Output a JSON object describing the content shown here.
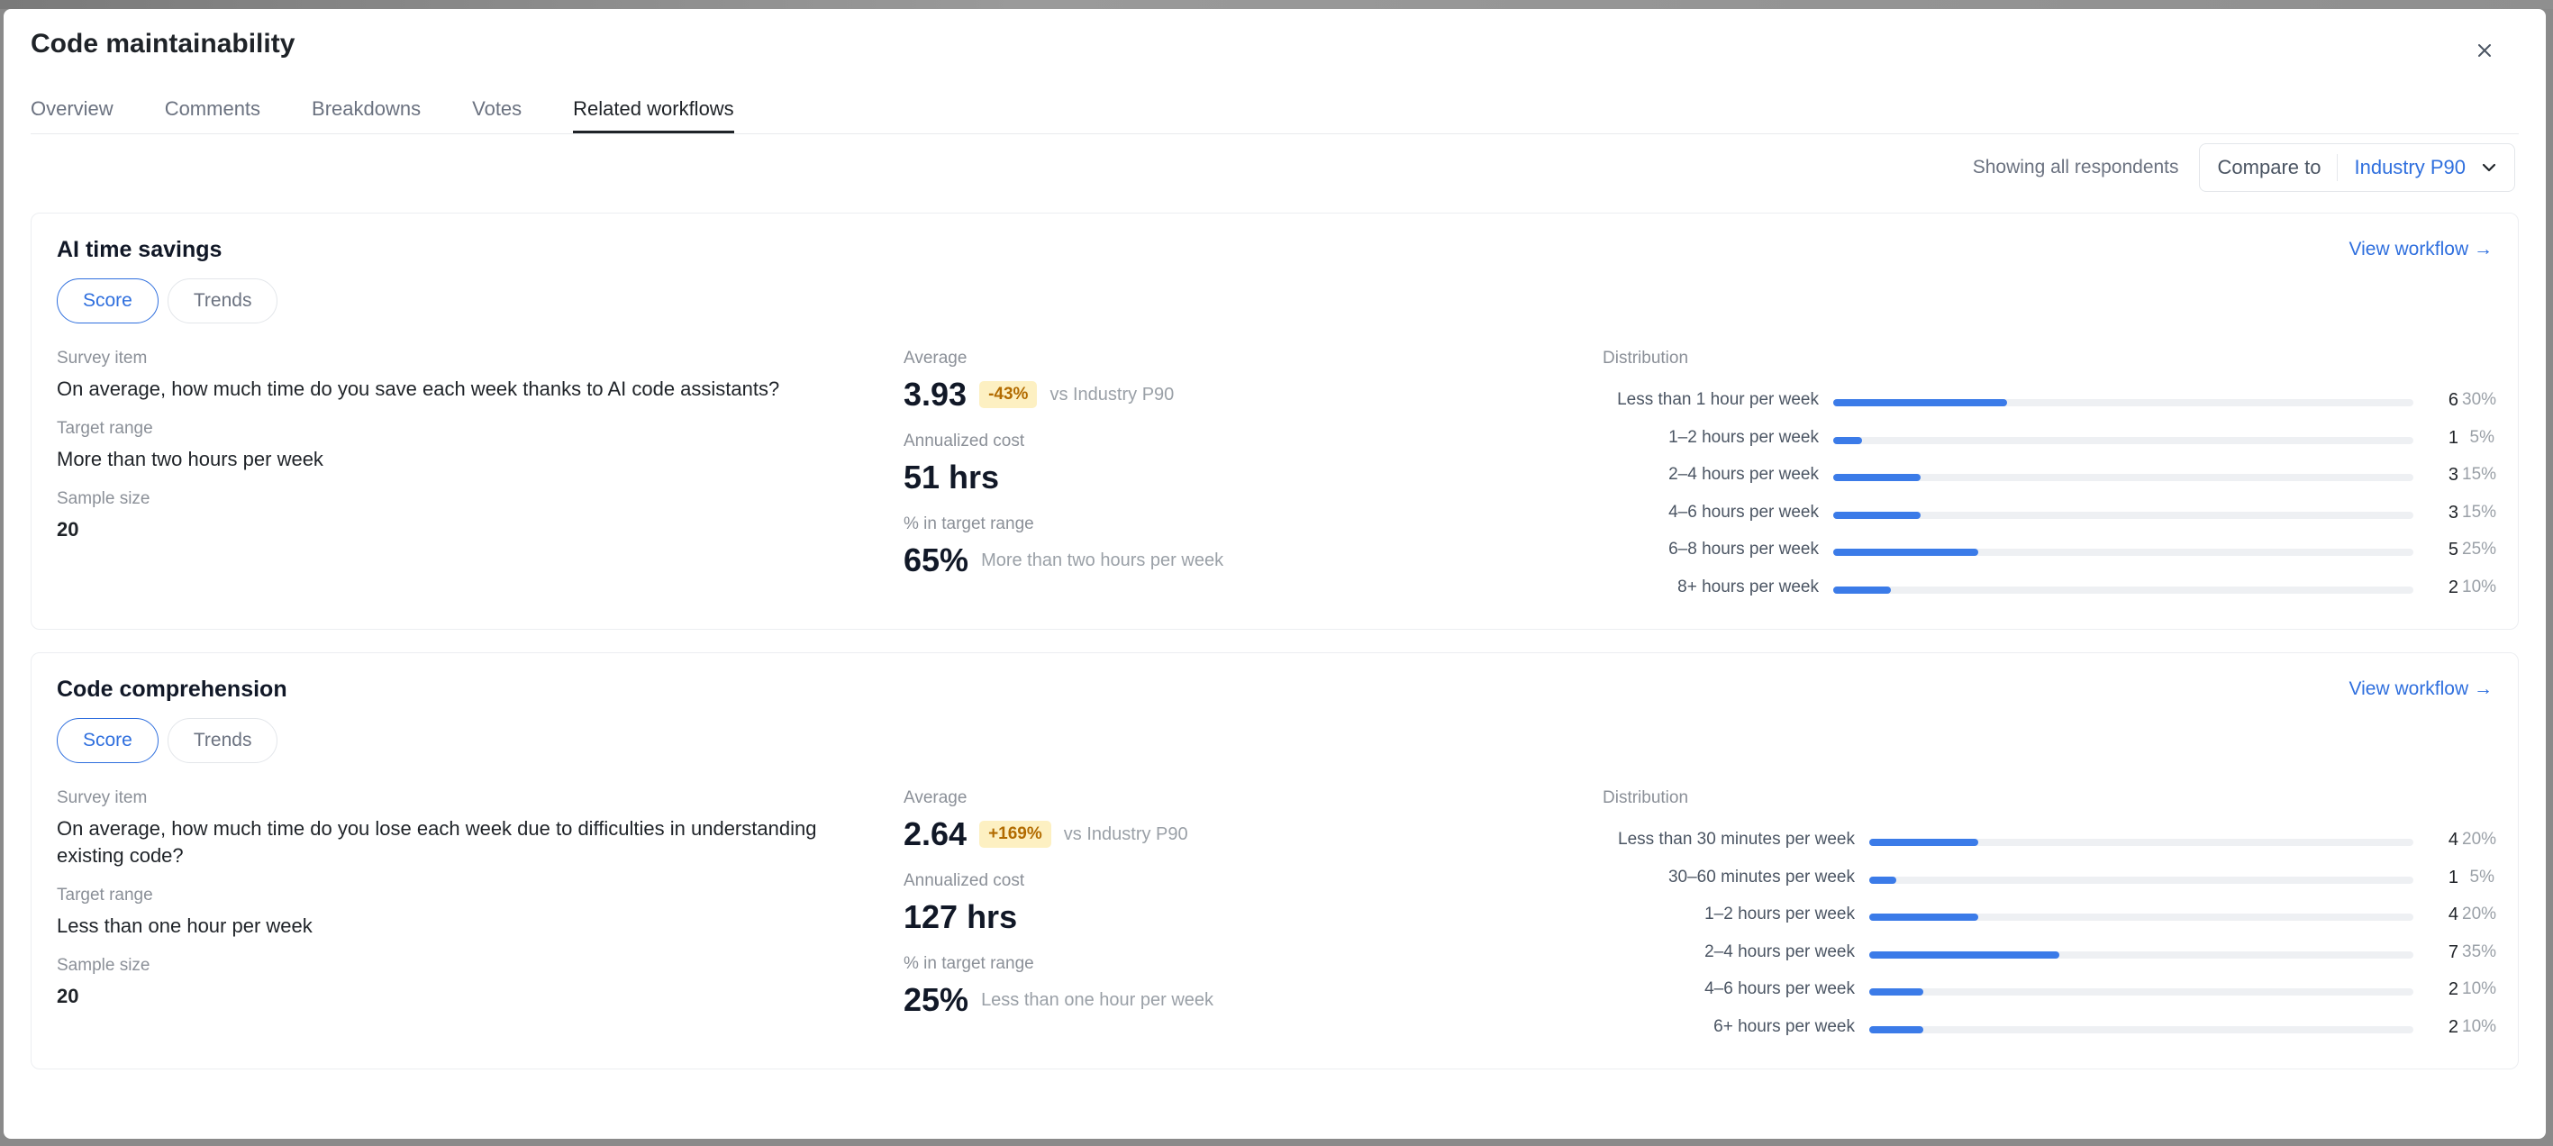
{
  "modal": {
    "title": "Code maintainability",
    "tabs": [
      {
        "label": "Overview",
        "active": false
      },
      {
        "label": "Comments",
        "active": false
      },
      {
        "label": "Breakdowns",
        "active": false
      },
      {
        "label": "Votes",
        "active": false
      },
      {
        "label": "Related workflows",
        "active": true
      }
    ]
  },
  "filter": {
    "showing": "Showing all respondents",
    "compare_label": "Compare to",
    "compare_value": "Industry P90"
  },
  "labels": {
    "survey_item": "Survey item",
    "target_range": "Target range",
    "sample_size": "Sample size",
    "average": "Average",
    "annualized_cost": "Annualized cost",
    "pct_in_target": "% in target range",
    "distribution": "Distribution",
    "view_workflow": "View workflow →",
    "score": "Score",
    "trends": "Trends"
  },
  "cards": [
    {
      "title": "AI time savings",
      "survey_item": "On average, how much time do you save each week thanks to AI code assistants?",
      "target_range": "More than two hours per week",
      "sample_size": "20",
      "average": "3.93",
      "badge": "-43%",
      "vs": "vs Industry P90",
      "annualized_cost": "51 hrs",
      "pct_in_target": "65%",
      "pct_in_target_note": "More than two hours per week",
      "distribution": [
        {
          "label": "Less than 1 hour per week",
          "count": "6",
          "pct": "30%",
          "fraction": 0.3
        },
        {
          "label": "1–2 hours per week",
          "count": "1",
          "pct": "5%",
          "fraction": 0.05
        },
        {
          "label": "2–4 hours per week",
          "count": "3",
          "pct": "15%",
          "fraction": 0.15
        },
        {
          "label": "4–6 hours per week",
          "count": "3",
          "pct": "15%",
          "fraction": 0.15
        },
        {
          "label": "6–8 hours per week",
          "count": "5",
          "pct": "25%",
          "fraction": 0.25
        },
        {
          "label": "8+ hours per week",
          "count": "2",
          "pct": "10%",
          "fraction": 0.1
        }
      ]
    },
    {
      "title": "Code comprehension",
      "survey_item": "On average, how much time do you lose each week due to difficulties in understanding existing code?",
      "target_range": "Less than one hour per week",
      "sample_size": "20",
      "average": "2.64",
      "badge": "+169%",
      "vs": "vs Industry P90",
      "annualized_cost": "127 hrs",
      "pct_in_target": "25%",
      "pct_in_target_note": "Less than one hour per week",
      "distribution": [
        {
          "label": "Less than 30 minutes per week",
          "count": "4",
          "pct": "20%",
          "fraction": 0.2
        },
        {
          "label": "30–60 minutes per week",
          "count": "1",
          "pct": "5%",
          "fraction": 0.05
        },
        {
          "label": "1–2 hours per week",
          "count": "4",
          "pct": "20%",
          "fraction": 0.2
        },
        {
          "label": "2–4 hours per week",
          "count": "7",
          "pct": "35%",
          "fraction": 0.35
        },
        {
          "label": "4–6 hours per week",
          "count": "2",
          "pct": "10%",
          "fraction": 0.1
        },
        {
          "label": "6+ hours per week",
          "count": "2",
          "pct": "10%",
          "fraction": 0.1
        }
      ]
    }
  ],
  "colors": {
    "accent": "#2f6fde",
    "bar": "#3b7be8",
    "badge_bg": "#fdf0c2",
    "badge_text": "#b26b00"
  },
  "icons": {
    "close": "close-icon",
    "chevron": "chevron-down-icon"
  }
}
